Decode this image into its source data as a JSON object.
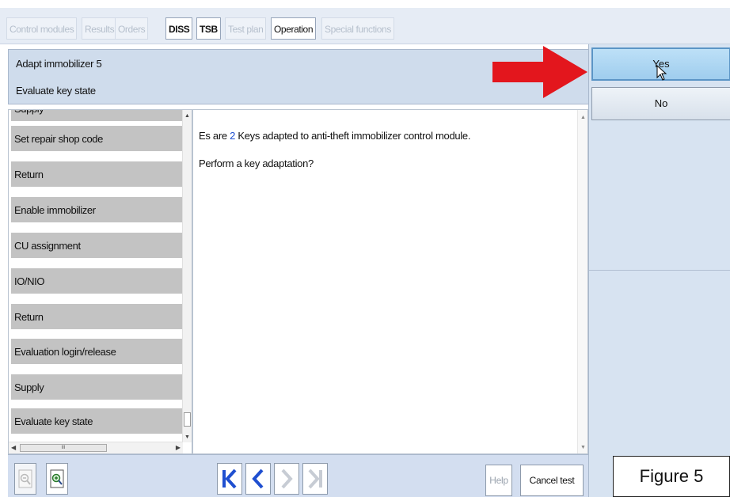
{
  "tabs": [
    {
      "label": "Control modules",
      "state": "disabled"
    },
    {
      "label": "Results",
      "state": "disabled"
    },
    {
      "label": "Orders",
      "state": "disabled"
    },
    {
      "label": "DISS",
      "state": "active"
    },
    {
      "label": "TSB",
      "state": "active"
    },
    {
      "label": "Test plan",
      "state": "disabled"
    },
    {
      "label": "Operation",
      "state": "selected"
    },
    {
      "label": "Special functions",
      "state": "disabled"
    }
  ],
  "header": {
    "title": "Adapt immobilizer 5",
    "subtitle": "Evaluate key state"
  },
  "steps": [
    "Supply",
    "Set repair shop code",
    "Return",
    "Enable immobilizer",
    "CU assignment",
    "IO/NIO",
    "Return",
    "Evaluation login/release",
    "Supply",
    "Evaluate key state"
  ],
  "hscroll_thumb": "III",
  "message": {
    "line1_prefix": "Es are ",
    "key_count": "2",
    "line1_suffix": " Keys adapted to anti-theft immobilizer control module.",
    "line2": "Perform a key adaptation?"
  },
  "buttons": {
    "yes": "Yes",
    "no": "No"
  },
  "toolbar": {
    "help": "Help",
    "cancel": "Cancel test"
  },
  "icons": {
    "zoom_out": "zoom-out-icon",
    "zoom_in": "zoom-in-icon",
    "first": "skip-first-icon",
    "prev": "previous-icon",
    "next": "next-icon",
    "last": "skip-last-icon"
  },
  "colors": {
    "highlight_arrow": "#e3161d",
    "nav_active": "#1f4fd0",
    "nav_disabled": "#c7ccd4",
    "yes_button": "#a9d4f1"
  },
  "figure_label": "Figure 5"
}
